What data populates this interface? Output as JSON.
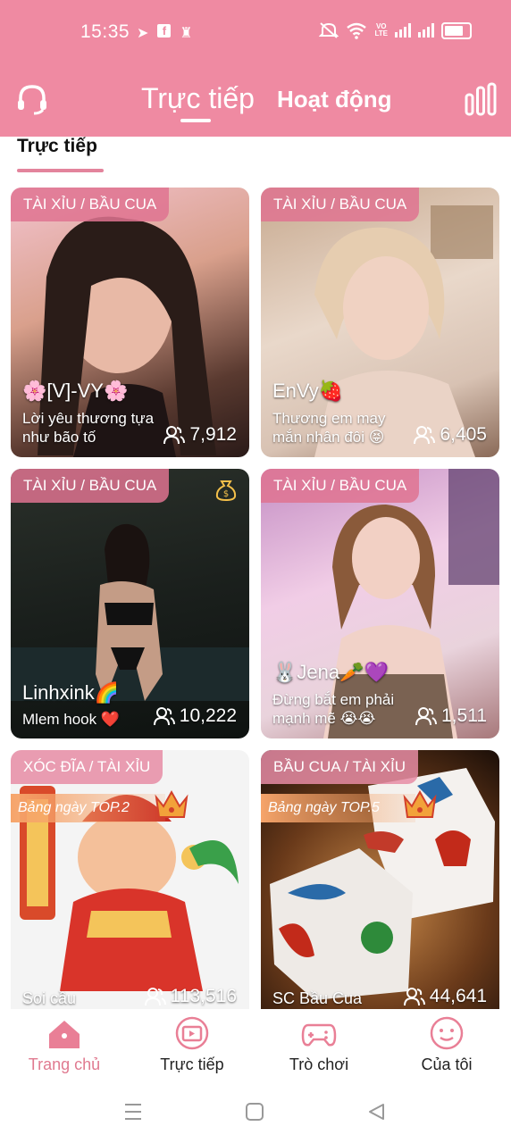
{
  "status": {
    "time": "15:35",
    "volte": [
      "VO",
      "LTE"
    ]
  },
  "nav": {
    "tab_live": "Trực tiếp",
    "tab_activity": "Hoạt động"
  },
  "section": {
    "title": "Trực tiếp"
  },
  "cards": [
    {
      "tag": "TÀI XỈU / BẦU CUA",
      "name": "🌸[V]-VY🌸",
      "desc": "Lời yêu thương tựa như bão tố",
      "viewers": "7,912"
    },
    {
      "tag": "TÀI XỈU / BẦU CUA",
      "name": "EnVy🍓",
      "desc": "Thương em may mắn nhân đôi 😝",
      "viewers": "6,405"
    },
    {
      "tag": "TÀI XỈU / BẦU CUA",
      "name": "Linhxink🌈",
      "desc": "Mlem hook ❤️",
      "viewers": "10,222"
    },
    {
      "tag": "TÀI XỈU / BẦU CUA",
      "name": "🐰Jena🥕💜",
      "desc": "Đừng bắt em phải mạnh mẽ 😭😭",
      "viewers": "1,511"
    },
    {
      "tag": "XÓC ĐĨA / TÀI XỈU",
      "rank": "Bảng ngày TOP.2",
      "name": "Soi cầu",
      "viewers": "113,516"
    },
    {
      "tag": "BẦU CUA / TÀI XỈU",
      "rank": "Bảng ngày TOP.5",
      "name": "SC Bầu Cua",
      "viewers": "44,641"
    }
  ],
  "tabbar": [
    {
      "label": "Trang chủ",
      "icon": "home-icon"
    },
    {
      "label": "Trực tiếp",
      "icon": "live-tv-icon"
    },
    {
      "label": "Trò chơi",
      "icon": "gamepad-icon"
    },
    {
      "label": "Của tôi",
      "icon": "profile-face-icon"
    }
  ],
  "colors": {
    "brand_pink": "#ef8aa2",
    "active_tab": "#e07a90",
    "rank_orange": "#f6a46a"
  }
}
